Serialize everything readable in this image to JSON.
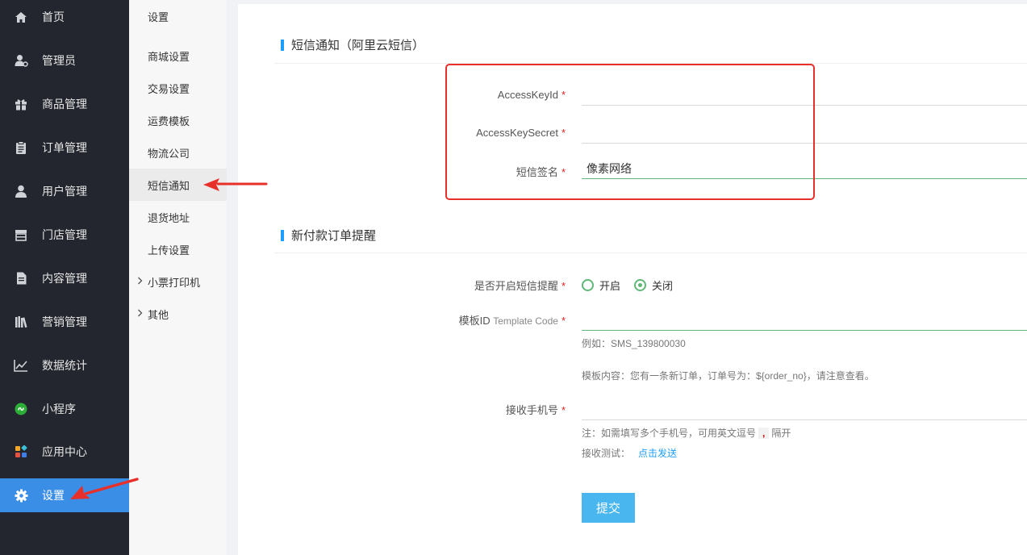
{
  "sidebar": {
    "items": [
      {
        "label": "首页",
        "icon": "home-icon"
      },
      {
        "label": "管理员",
        "icon": "admin-icon"
      },
      {
        "label": "商品管理",
        "icon": "gift-icon"
      },
      {
        "label": "订单管理",
        "icon": "clipboard-icon"
      },
      {
        "label": "用户管理",
        "icon": "user-icon"
      },
      {
        "label": "门店管理",
        "icon": "store-icon"
      },
      {
        "label": "内容管理",
        "icon": "document-icon"
      },
      {
        "label": "营销管理",
        "icon": "books-icon"
      },
      {
        "label": "数据统计",
        "icon": "chart-icon"
      },
      {
        "label": "小程序",
        "icon": "miniprogram-icon"
      },
      {
        "label": "应用中心",
        "icon": "apps-icon"
      },
      {
        "label": "设置",
        "icon": "gear-icon",
        "active": true
      }
    ]
  },
  "subnav": {
    "title": "设置",
    "items": [
      {
        "label": "商城设置"
      },
      {
        "label": "交易设置"
      },
      {
        "label": "运费模板"
      },
      {
        "label": "物流公司"
      },
      {
        "label": "短信通知",
        "active": true
      },
      {
        "label": "退货地址"
      },
      {
        "label": "上传设置"
      },
      {
        "label": "小票打印机",
        "expandable": true
      },
      {
        "label": "其他",
        "expandable": true
      }
    ]
  },
  "sms": {
    "section_title": "短信通知（阿里云短信）",
    "access_key_id": {
      "label": "AccessKeyId",
      "value": ""
    },
    "access_key_secret": {
      "label": "AccessKeySecret",
      "value": ""
    },
    "sign_name": {
      "label": "短信签名",
      "value": "像素网络"
    },
    "required_mark": "*"
  },
  "new_order": {
    "section_title": "新付款订单提醒",
    "enable": {
      "label": "是否开启短信提醒",
      "options": [
        "开启",
        "关闭"
      ],
      "selected": "关闭"
    },
    "template": {
      "label": "模板ID",
      "label_small": "Template Code",
      "value": "",
      "example": "例如：SMS_139800030",
      "content": "模板内容：您有一条新订单，订单号为：${order_no}，请注意查看。"
    },
    "phone": {
      "label": "接收手机号",
      "value": "",
      "note_before": "注：如需填写多个手机号，可用英文逗号",
      "note_code": ",",
      "note_after": "隔开",
      "test_label": "接收测试：",
      "test_link": "点击发送"
    }
  },
  "submit_label": "提交",
  "colors": {
    "accent": "#3a8ee6",
    "sidebar_bg": "#23262e",
    "required": "#e02020",
    "link": "#1e9fff",
    "highlight": "#e8302a"
  }
}
